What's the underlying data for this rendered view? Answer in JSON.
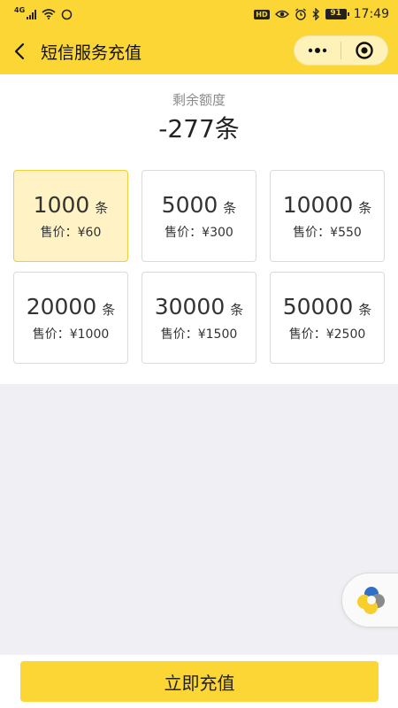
{
  "status_bar": {
    "network": "4G",
    "hd": "HD",
    "battery": "91",
    "time": "17:49"
  },
  "header": {
    "title": "短信服务充值",
    "back_icon": "chevron-left-icon",
    "more_icon": "more-dots-icon",
    "close_icon": "target-close-icon"
  },
  "quota": {
    "label": "剩余额度",
    "value": "-277条"
  },
  "packages": [
    {
      "amount": "1000",
      "unit": "条",
      "price": "售价：¥60",
      "selected": true
    },
    {
      "amount": "5000",
      "unit": "条",
      "price": "售价：¥300",
      "selected": false
    },
    {
      "amount": "10000",
      "unit": "条",
      "price": "售价：¥550",
      "selected": false
    },
    {
      "amount": "20000",
      "unit": "条",
      "price": "售价：¥1000",
      "selected": false
    },
    {
      "amount": "30000",
      "unit": "条",
      "price": "售价：¥1500",
      "selected": false
    },
    {
      "amount": "50000",
      "unit": "条",
      "price": "售价：¥2500",
      "selected": false
    }
  ],
  "recharge_button": "立即充值",
  "colors": {
    "accent": "#fbd634",
    "selected_bg": "#fff2c4",
    "page_bg": "#efeff4"
  }
}
